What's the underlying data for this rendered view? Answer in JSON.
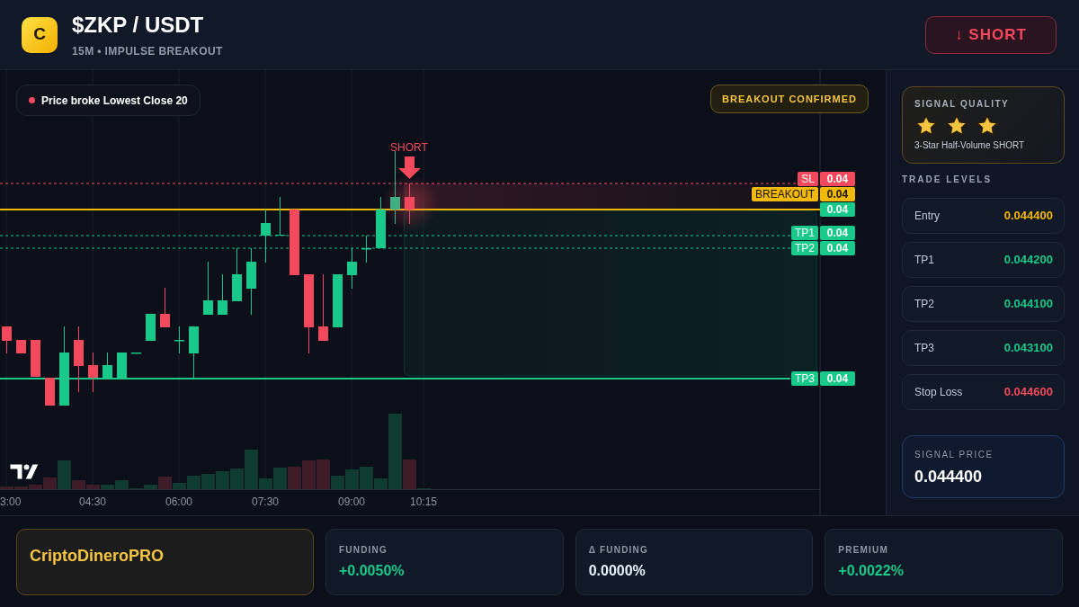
{
  "header": {
    "logo_letter": "C",
    "title": "$ZKP / USDT",
    "subtitle": "15M • IMPULSE BREAKOUT",
    "signal_button": {
      "label": "↓ SHORT",
      "kind": "short"
    }
  },
  "chart": {
    "legend": {
      "text": "Price broke Lowest Close 20"
    },
    "badge": "BREAKOUT CONFIRMED",
    "marker": {
      "label": "SHORT",
      "kind": "short"
    },
    "price_labels": [
      {
        "kind": "sl",
        "tag": "SL",
        "value": "0.04"
      },
      {
        "kind": "breakout",
        "tag": "BREAKOUT",
        "value": "0.04"
      },
      {
        "kind": "entry",
        "value": "0.04"
      },
      {
        "kind": "tp",
        "tag": "TP1",
        "value": "0.04"
      },
      {
        "kind": "tp",
        "tag": "TP2",
        "value": "0.04"
      },
      {
        "kind": "tp_final",
        "tag": "TP3",
        "value": "0.04"
      }
    ],
    "time_labels": [
      "3:00",
      "04:30",
      "06:00",
      "07:30",
      "09:00",
      "10:15"
    ]
  },
  "signal_quality": {
    "title": "SIGNAL QUALITY",
    "stars": 3,
    "caption": "3-Star Half-Volume SHORT"
  },
  "trade_levels": {
    "title": "TRADE LEVELS",
    "rows": [
      {
        "label": "Entry",
        "value": "0.044400",
        "kind": "entry"
      },
      {
        "label": "TP1",
        "value": "0.044200",
        "kind": "tp"
      },
      {
        "label": "TP2",
        "value": "0.044100",
        "kind": "tp"
      },
      {
        "label": "TP3",
        "value": "0.043100",
        "kind": "tp"
      },
      {
        "label": "Stop Loss",
        "value": "0.044600",
        "kind": "sl"
      }
    ]
  },
  "signal_price": {
    "label": "SIGNAL PRICE",
    "value": "0.044400"
  },
  "footer": {
    "brand": "CriptoDineroPRO",
    "metrics": [
      {
        "label": "FUNDING",
        "value": "+0.0050%",
        "kind": "positive"
      },
      {
        "label": "Δ FUNDING",
        "value": "0.0000%",
        "kind": "neutral"
      },
      {
        "label": "PREMIUM",
        "value": "+0.0022%",
        "kind": "positive"
      }
    ]
  }
}
